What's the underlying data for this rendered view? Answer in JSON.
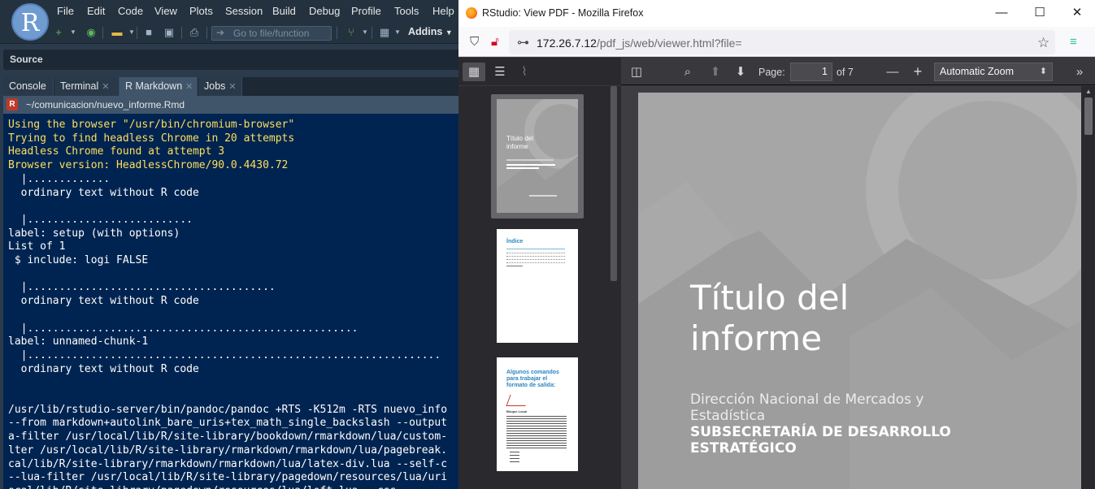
{
  "rstudio": {
    "logo": "R",
    "menu": [
      "File",
      "Edit",
      "Code",
      "View",
      "Plots",
      "Session",
      "Build",
      "Debug",
      "Profile",
      "Tools",
      "Help"
    ],
    "toolbar": {
      "goto_placeholder": "Go to file/function",
      "addins_label": "Addins",
      "icons": [
        "new-file-icon",
        "new-project-icon",
        "open-folder-icon",
        "save-icon",
        "save-all-icon",
        "print-icon",
        "git-icon",
        "grid-icon"
      ]
    },
    "source_label": "Source",
    "tabs": [
      {
        "label": "Console",
        "active": false,
        "closable": false
      },
      {
        "label": "Terminal",
        "active": false,
        "closable": true
      },
      {
        "label": "R Markdown",
        "active": true,
        "closable": true
      },
      {
        "label": "Jobs",
        "active": false,
        "closable": true
      }
    ],
    "path": "~/comunicacion/nuevo_informe.Rmd",
    "console_lines": [
      {
        "text": "Using the browser \"/usr/bin/chromium-browser\"",
        "color": "yellow"
      },
      {
        "text": "Trying to find headless Chrome in 20 attempts",
        "color": "yellow"
      },
      {
        "text": "Headless Chrome found at attempt 3",
        "color": "yellow"
      },
      {
        "text": "Browser version: HeadlessChrome/90.0.4430.72",
        "color": "yellow"
      },
      {
        "text": "  |.............",
        "color": "white"
      },
      {
        "text": "  ordinary text without R code",
        "color": "white"
      },
      {
        "text": "",
        "color": "white"
      },
      {
        "text": "  |..........................",
        "color": "white"
      },
      {
        "text": "label: setup (with options)",
        "color": "white"
      },
      {
        "text": "List of 1",
        "color": "white"
      },
      {
        "text": " $ include: logi FALSE",
        "color": "white"
      },
      {
        "text": "",
        "color": "white"
      },
      {
        "text": "  |.......................................",
        "color": "white"
      },
      {
        "text": "  ordinary text without R code",
        "color": "white"
      },
      {
        "text": "",
        "color": "white"
      },
      {
        "text": "  |....................................................",
        "color": "white"
      },
      {
        "text": "label: unnamed-chunk-1",
        "color": "white"
      },
      {
        "text": "  |.................................................................",
        "color": "white"
      },
      {
        "text": "  ordinary text without R code",
        "color": "white"
      },
      {
        "text": "",
        "color": "white"
      },
      {
        "text": "",
        "color": "white"
      },
      {
        "text": "/usr/lib/rstudio-server/bin/pandoc/pandoc +RTS -K512m -RTS nuevo_info",
        "color": "white"
      },
      {
        "text": "--from markdown+autolink_bare_uris+tex_math_single_backslash --output",
        "color": "white"
      },
      {
        "text": "a-filter /usr/local/lib/R/site-library/bookdown/rmarkdown/lua/custom-",
        "color": "white"
      },
      {
        "text": "lter /usr/local/lib/R/site-library/rmarkdown/rmarkdown/lua/pagebreak.",
        "color": "white"
      },
      {
        "text": "cal/lib/R/site-library/rmarkdown/rmarkdown/lua/latex-div.lua --self-c",
        "color": "white"
      },
      {
        "text": "--lua-filter /usr/local/lib/R/site-library/pagedown/resources/lua/uri",
        "color": "white"
      },
      {
        "text": "ocal/lib/R/site-library/pagedown/resources/lua/loft.lua --css",
        "color": "white"
      }
    ],
    "colors": {
      "console_bg": "#002451",
      "yellow": "#ffdf5d",
      "white": "#ffffff"
    }
  },
  "firefox": {
    "window_title": "RStudio: View PDF - Mozilla Firefox",
    "url_host": "172.26.7.12",
    "url_path": "/pdf_js/web/viewer.html?file=",
    "pdf_toolbar": {
      "page_label": "Page:",
      "page_value": "1",
      "page_count": "of 7",
      "zoom_value": "Automatic Zoom"
    },
    "thumbnails": [
      {
        "page": 1,
        "title": "Título del informe",
        "selected": true
      },
      {
        "page": 2,
        "title": "Índice",
        "selected": false
      },
      {
        "page": 3,
        "title": "Algunos comandos para trabajar el formato de salida:",
        "subtitle": "Bloque Local",
        "selected": false
      }
    ],
    "pdf_page": {
      "title_line1": "Título del",
      "title_line2": "informe",
      "subtitle": "Dirección Nacional de Mercados y Estadística",
      "department": "SUBSECRETARÍA DE DESARROLLO ESTRATÉGICO"
    },
    "colors": {
      "page_bg": "#a6a6a6",
      "toolbar_bg": "#38383d",
      "sidebar_bg": "#2a2a2e"
    }
  }
}
